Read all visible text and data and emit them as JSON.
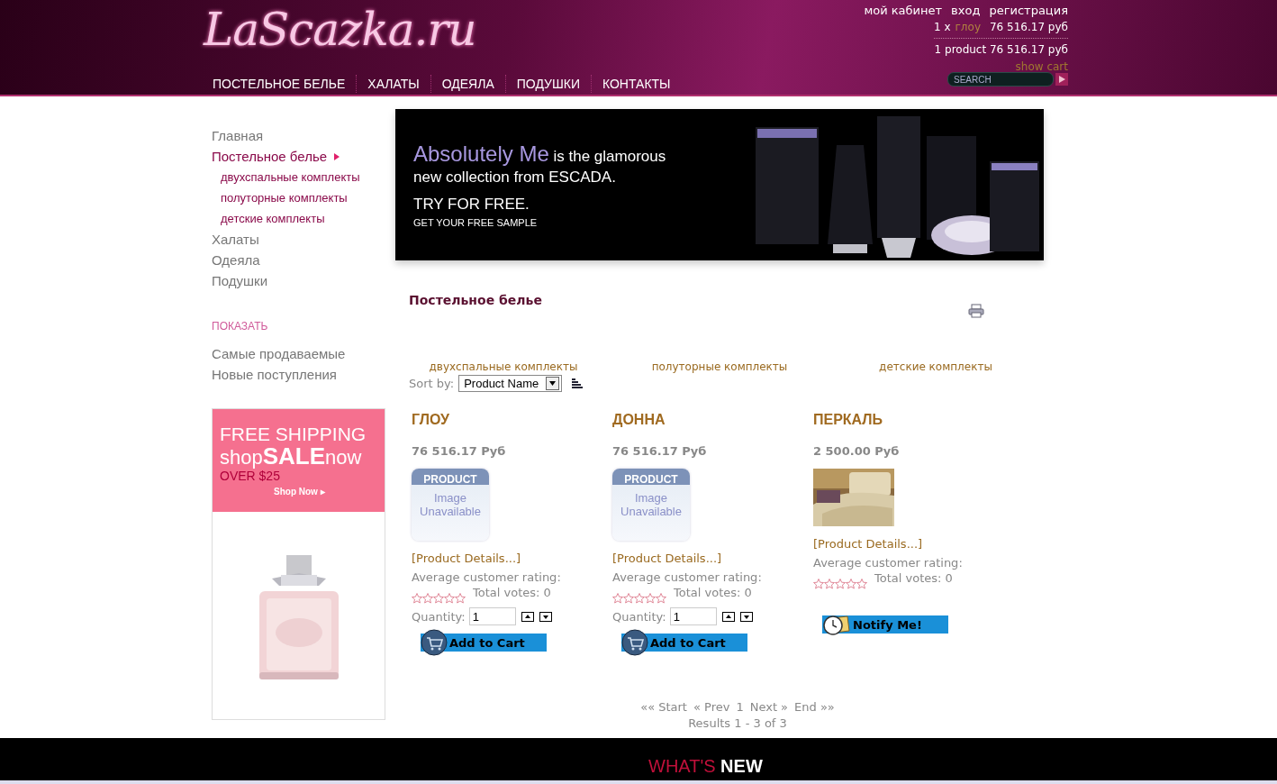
{
  "header": {
    "logo": "LaScazka.ru",
    "account_links": [
      "мой кабинет",
      "вход",
      "регистрация"
    ],
    "cart_line": {
      "qty": "1 x",
      "item": "глоу",
      "price": "76 516.17 руб"
    },
    "cart_total": "1 product 76 516.17 руб",
    "show_cart": "show cart",
    "search": {
      "placeholder": "SEARCH"
    },
    "nav": [
      "ПОСТЕЛЬНОЕ БЕЛЬЕ",
      "ХАЛАТЫ",
      "ОДЕЯЛА",
      "ПОДУШКИ",
      "КОНТАКТЫ"
    ]
  },
  "sidebar": {
    "items": [
      {
        "label": "Главная",
        "selected": false
      },
      {
        "label": "Постельное белье",
        "selected": true,
        "children": [
          {
            "label": "двухспальные комплекты"
          },
          {
            "label": "полуторные комплекты"
          },
          {
            "label": "детские комплекты"
          }
        ]
      },
      {
        "label": "Халаты",
        "selected": false
      },
      {
        "label": "Одеяла",
        "selected": false
      },
      {
        "label": "Подушки",
        "selected": false
      }
    ],
    "show_heading": "ПОКАЗАТЬ",
    "show_items": [
      "Самые продаваемые",
      "Новые поступления"
    ],
    "ad": {
      "line1": "FREE SHIPPING",
      "line2_pre": "shop",
      "line2_bold": "SALE",
      "line2_post": "now",
      "line3": "OVER $25",
      "cta": "Shop Now ▸"
    }
  },
  "banner": {
    "brand": "Absolutely Me",
    "headline_rest": "is the glamorous",
    "line2": "new collection from ESCADA.",
    "line3": "TRY FOR FREE.",
    "line4": "GET YOUR FREE SAMPLE"
  },
  "category": {
    "title": "Постельное белье",
    "subcategories": [
      "двухспальные комплекты",
      "полуторные комплекты",
      "детские комплекты"
    ],
    "sort": {
      "label": "Sort by:",
      "value": "Product Name"
    }
  },
  "products": [
    {
      "name": "ГЛОУ",
      "price": "76 516.17 Руб",
      "placeholder_top": "PRODUCT",
      "placeholder_text": "Image Unavailable",
      "details": "[Product Details...]",
      "rating_label": "Average customer rating:",
      "stars": 0,
      "votes": "Total votes: 0",
      "quantity_label": "Quantity:",
      "quantity": "1",
      "action": "Add to Cart"
    },
    {
      "name": "ДОННА",
      "price": "76 516.17 Руб",
      "placeholder_top": "PRODUCT",
      "placeholder_text": "Image Unavailable",
      "details": "[Product Details...]",
      "rating_label": "Average customer rating:",
      "stars": 0,
      "votes": "Total votes: 0",
      "quantity_label": "Quantity:",
      "quantity": "1",
      "action": "Add to Cart"
    },
    {
      "name": "ПЕРКАЛЬ",
      "price": "2 500.00 Руб",
      "details": "[Product Details...]",
      "rating_label": "Average customer rating:",
      "stars": 0,
      "votes": "Total votes: 0",
      "action": "Notify Me!"
    }
  ],
  "pagination": {
    "links": [
      "«« Start",
      "« Prev",
      "1",
      "Next »",
      "End »»"
    ],
    "results": "Results 1 - 3 of 3"
  },
  "footer": {
    "heading_pre": "WHAT'S",
    "heading_post": "NEW"
  }
}
